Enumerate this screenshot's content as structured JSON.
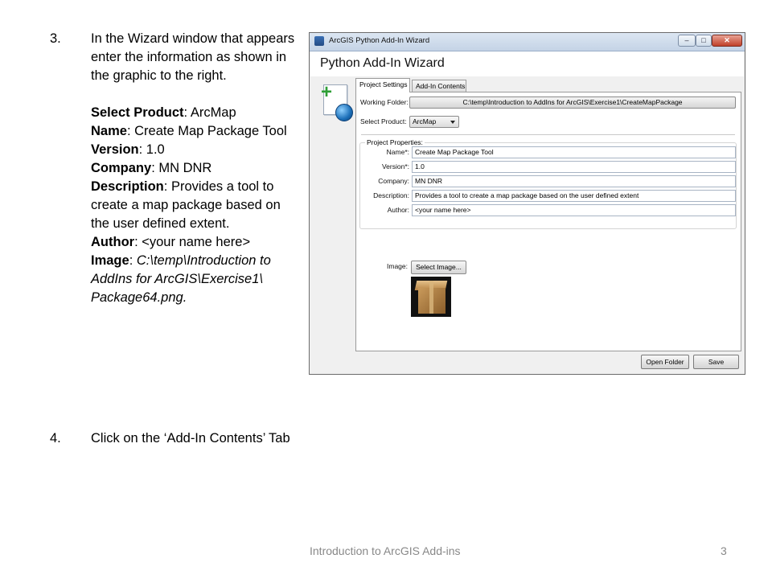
{
  "steps": {
    "step3": {
      "number": "3.",
      "intro": "In the Wizard window that appears enter the information as shown in the graphic to the right.",
      "fields": [
        {
          "label": "Select Product",
          "sep": ": ",
          "value": "ArcMap"
        },
        {
          "label": "Name",
          "sep": ": ",
          "value": "Create Map Package Tool"
        },
        {
          "label": "Version",
          "sep": ": ",
          "value": "1.0"
        },
        {
          "label": "Company",
          "sep": ": ",
          "value": "MN DNR"
        }
      ],
      "description_label": "Description",
      "description_sep": ": ",
      "description_value": "Provides a tool to create a map package based on the user defined extent.",
      "author_label": "Author",
      "author_sep": ": ",
      "author_value": "<your name here>",
      "image_label": "Image",
      "image_sep": ":  ",
      "image_value": "C:\\temp\\Introduction to AddIns for ArcGIS\\Exercise1\\ Package64.png",
      "image_suffix": "."
    },
    "step4": {
      "number": "4.",
      "text": "Click on the ‘Add-In Contents’ Tab"
    }
  },
  "footer": {
    "text": "Introduction to ArcGIS Add-ins",
    "page": "3"
  },
  "wizard": {
    "window_title": "ArcGIS Python Add-In Wizard",
    "header_title": "Python Add-In Wizard",
    "window_buttons": {
      "minimize": "–",
      "maximize": "□",
      "close": "✕"
    },
    "tabs": [
      {
        "label": "Project Settings",
        "active": true
      },
      {
        "label": "Add-In Contents",
        "active": false
      }
    ],
    "working_folder_label": "Working Folder:",
    "working_folder_value": "C:\\temp\\Introduction to AddIns for ArcGIS\\Exercise1\\CreateMapPackage",
    "select_product_label": "Select Product:",
    "select_product_value": "ArcMap",
    "project_properties_label": "Project Properties:",
    "properties": [
      {
        "label": "Name*:",
        "value": "Create Map Package Tool"
      },
      {
        "label": "Version*:",
        "value": "1.0"
      },
      {
        "label": "Company:",
        "value": "MN DNR"
      },
      {
        "label": "Description:",
        "value": "Provides a tool to create a map package based on the user defined extent"
      },
      {
        "label": "Author:",
        "value": "<your name here>"
      }
    ],
    "image_label": "Image:",
    "select_image_button": "Select Image...",
    "open_folder_button": "Open Folder",
    "save_button": "Save",
    "icons": {
      "logo": "addin-wizard-logo-icon",
      "package": "package-box-icon"
    }
  }
}
